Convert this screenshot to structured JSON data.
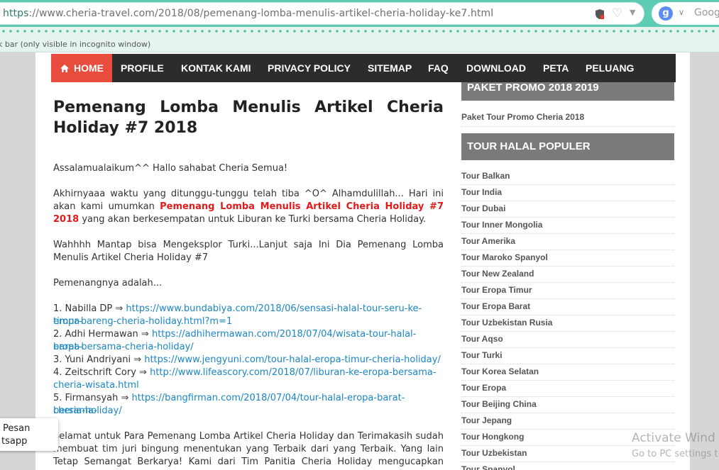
{
  "browser": {
    "url_protocol": "https",
    "url_rest": "://www.cheria-travel.com/2018/08/pemenang-lomba-menulis-artikel-cheria-holiday-ke7.html",
    "search_text": "Goog",
    "infobar_text": "k bar (only visible in incognito window)"
  },
  "nav": {
    "items": [
      "HOME",
      "PROFILE",
      "KONTAK KAMI",
      "PRIVACY POLICY",
      "SITEMAP",
      "FAQ",
      "DOWNLOAD",
      "PETA",
      "PELUANG"
    ]
  },
  "article": {
    "title_line1": "Pemenang Lomba Menulis Artikel Cheria",
    "title_line2": "Holiday #7 2018",
    "p1": "Assalamualaikum^^ Hallo sahabat Cheria Semua!",
    "p2_a": "Akhirnyaaa waktu yang ditunggu-tunggu telah tiba ^O^ Alhamdulillah... Hari ini akan kami umumkan ",
    "p2_highlight": "Pemenang Lomba Menulis Artikel Cheria Holiday #7 2018",
    "p2_b": " yang akan berkesempatan untuk Liburan ke Turki bersama Cheria Holiday.",
    "p3": "Wahhhh Mantap bisa Mengeksplor Turki...Lanjut saja Ini Dia Pemenang Lomba Menulis Artikel Cheria Holiday #7",
    "p4": "Pemenangnya adalah...",
    "winners": [
      {
        "name": "1. Nabilla DP ⇒ ",
        "link_a": "https://www.bundabiya.com/2018/06/sensasi-halal-tour-seru-ke-eropa-",
        "link_b": "timur-bareng-cheria-holiday.html?m=1"
      },
      {
        "name": "2. Adhi Hermawan ⇒ ",
        "link_a": "https://adhihermawan.com/2018/07/04/wisata-tour-halal-eropa-",
        "link_b": "barat-bersama-cheria-holiday/"
      },
      {
        "name": "3. Yuni Andriyani ⇒ ",
        "link_a": "https://www.jengyuni.com/tour-halal-eropa-timur-cheria-holiday/",
        "link_b": ""
      },
      {
        "name": "4. Zeitschrift Cory ⇒ ",
        "link_a": "http://www.lifeascory.com/2018/07/liburan-ke-eropa-bersama-",
        "link_b": "cheria-wisata.html"
      },
      {
        "name": "5. Firmansyah ⇒ ",
        "link_a": "https://bangfirman.com/2018/07/04/tour-halal-eropa-barat-bersama-",
        "link_b": "cheria-holiday/"
      }
    ],
    "p5": "Selamat untuk Para Pemenang Lomba Artikel Cheria Holiday dan Terimakasih sudah membuat tim juri bingung menentukan yang Terbaik dari yang Terbaik. Yang lain Tetap Semangat Berkarya! Kami dari Tim Panitia Cheria Holiday mengucapkan Terima kasih atas"
  },
  "sidebar": {
    "promo_heading": "PAKET PROMO 2018 2019",
    "promo_item": "Paket Tour Promo Cheria 2018",
    "halal_heading": "TOUR HALAL POPULER",
    "items": [
      "Tour Balkan",
      "Tour India",
      "Tour Dubai",
      "Tour Inner Mongolia",
      "Tour Amerika",
      "Tour Maroko Spanyol",
      "Tour New Zealand",
      "Tour Eropa Timur",
      "Tour Eropa Barat",
      "Tour Uzbekistan Rusia",
      "Tour Aqso",
      "Tour Turki",
      "Tour Korea Selatan",
      "Tour Eropa",
      "Tour Beijing China",
      "Tour Jepang",
      "Tour Hongkong",
      "Tour Uzbekistan",
      "Tour Spanyol"
    ]
  },
  "chat": {
    "line1": "Pesan",
    "line2": "tsapp"
  },
  "watermark": {
    "line1": "Activate Wind",
    "line2": "Go to PC settings t"
  },
  "colors": {
    "nav_bg": "#2c2c2c",
    "home_active": "#e74c3c",
    "highlight_red": "#e11b1b",
    "link_blue": "#1a86c4",
    "sidebar_heading": "#7a7a7a",
    "browser_accent": "#5ecbb4"
  }
}
